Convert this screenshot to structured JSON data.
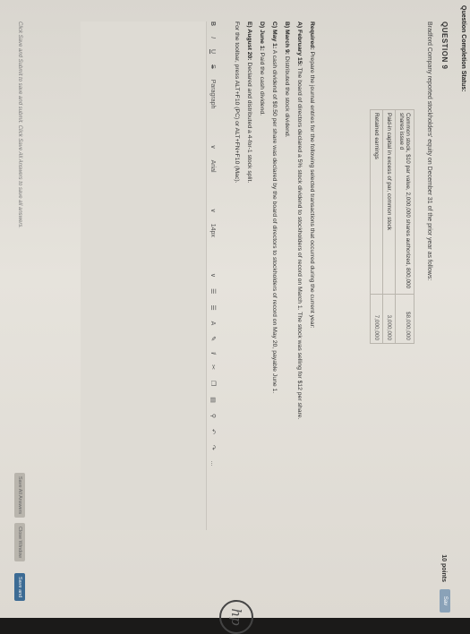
{
  "header": {
    "status": "Question Completion Status:",
    "question": "QUESTION 9",
    "points": "10 points",
    "save": "Sav"
  },
  "intro": "Bradford Company reported stockholders' equity on December 31 of the prior year as follows:",
  "equity_table": [
    {
      "label": "Common stock, $10 par value, 2,000,000 shares authorized, 800,000 shares issue d",
      "value": "$8,000,000"
    },
    {
      "label": "Paid-in capital in excess of par, common stock",
      "value": "3,000,000"
    },
    {
      "label": "Retained earnings",
      "value": "7,000,000"
    }
  ],
  "required": {
    "title": "Required:",
    "title_text": "Prepare the journal entries for the following selected transactions that occurred during the current year:",
    "items": [
      {
        "key": "A) February 15:",
        "text": "The board of directors declared a 5% stock dividend to stockholders of record on March 1. The stock was selling for $12 per share."
      },
      {
        "key": "B) March 9:",
        "text": "Distributed the stock dividend."
      },
      {
        "key": "C) May 1:",
        "text": "A cash dividend of $0.50 per share was declared by the board of directors to stockholders of record on May 20, payable June 1."
      },
      {
        "key": "D) June 1:",
        "text": "Paid the cash dividend."
      },
      {
        "key": "E) August 20:",
        "text": "Declared and distributed a 4-for-1 stock split."
      },
      {
        "key": "",
        "text": "For the toolbar, press ALT+F10 (PC) or ALT+FN+F10 (Mac)."
      }
    ]
  },
  "toolbar": {
    "bold": "B",
    "italic": "I",
    "underline": "U",
    "strike": "S",
    "paragraph": "Paragraph",
    "font": "Arial",
    "size": "14px",
    "more": "..."
  },
  "footer": {
    "hint": "Click Save and Submit to save and submit. Click Save All Answers to save all answers.",
    "save_all": "Save All Answers",
    "close_window": "Close Window",
    "save_submit": "Save and"
  },
  "brand": "hp"
}
